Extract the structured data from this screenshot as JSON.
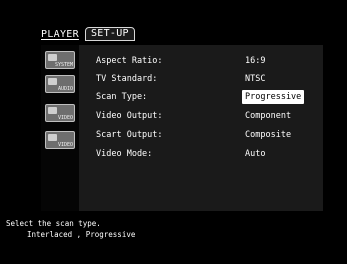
{
  "tabs": {
    "player": "PLAYER",
    "setup": "SET-UP"
  },
  "sidebar": {
    "items": [
      {
        "label": "SYSTEM",
        "icon": "system-icon"
      },
      {
        "label": "AUDIO",
        "icon": "audio-icon"
      },
      {
        "label": "VIDEO",
        "icon": "video-icon"
      },
      {
        "label": "VIDEO",
        "icon": "scart-video-icon"
      }
    ]
  },
  "settings": [
    {
      "label": "Aspect Ratio:",
      "value": "16:9"
    },
    {
      "label": "TV Standard:",
      "value": "NTSC"
    },
    {
      "label": "Scan Type:",
      "value": "Progressive",
      "selected": true
    },
    {
      "label": "Video Output:",
      "value": "Component"
    },
    {
      "label": "Scart Output:",
      "value": "Composite"
    },
    {
      "label": "Video Mode:",
      "value": "Auto"
    }
  ],
  "help": {
    "line1": "Select the scan type.",
    "line2": "Interlaced , Progressive"
  },
  "colors": {
    "background": "#000000",
    "panel": "#1a1a1a",
    "highlight": "#ffffff"
  }
}
